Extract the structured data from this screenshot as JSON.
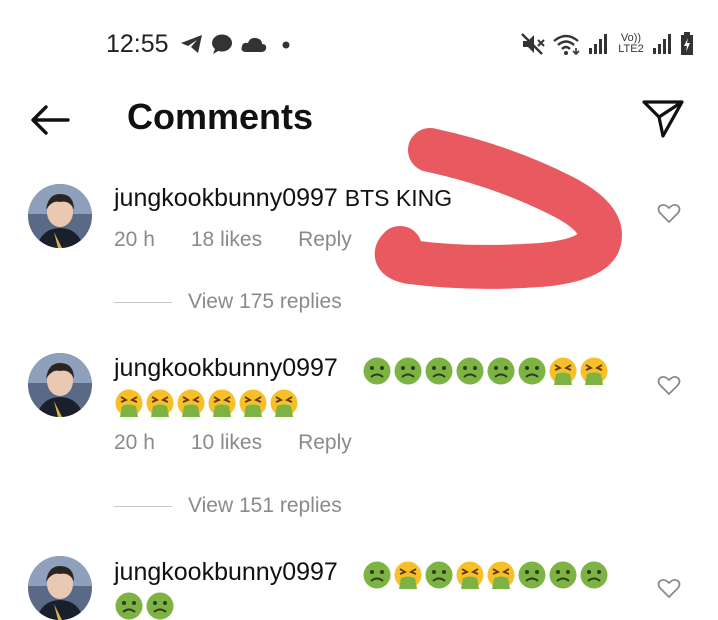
{
  "status_bar": {
    "time": "12:55",
    "left_icons": [
      "telegram-icon",
      "message-icon",
      "cloud-icon",
      "dot-icon"
    ],
    "right_icons": [
      "mute-icon",
      "wifi-icon",
      "signal-icon",
      "volte-icon",
      "signal-icon",
      "battery-charging-icon"
    ],
    "volte_label": "Vo)) LTE2"
  },
  "header": {
    "title": "Comments"
  },
  "comments": [
    {
      "username": "jungkookbunny0997",
      "text": "BTS KING",
      "time": "20 h",
      "likes": "18 likes",
      "reply": "Reply",
      "view_replies": "View 175 replies"
    },
    {
      "username": "jungkookbunny0997",
      "emojis_line1": [
        "nauseated-face",
        "nauseated-face",
        "nauseated-face",
        "nauseated-face",
        "nauseated-face",
        "nauseated-face",
        "vomiting-face",
        "vomiting-face"
      ],
      "emojis_line2": [
        "vomiting-face",
        "vomiting-face",
        "vomiting-face",
        "vomiting-face",
        "vomiting-face",
        "vomiting-face"
      ],
      "time": "20 h",
      "likes": "10 likes",
      "reply": "Reply",
      "view_replies": "View 151 replies"
    },
    {
      "username": "jungkookbunny0997",
      "emojis_line1": [
        "nauseated-face",
        "vomiting-face",
        "nauseated-face",
        "vomiting-face",
        "vomiting-face",
        "nauseated-face",
        "nauseated-face",
        "nauseated-face"
      ],
      "emojis_line2": [
        "nauseated-face",
        "nauseated-face"
      ]
    }
  ],
  "colors": {
    "scribble": "#e85a5f",
    "muted_text": "#8a8a8a",
    "nauseated_green": "#7cb342",
    "vomit_yellow": "#f7c02b"
  }
}
